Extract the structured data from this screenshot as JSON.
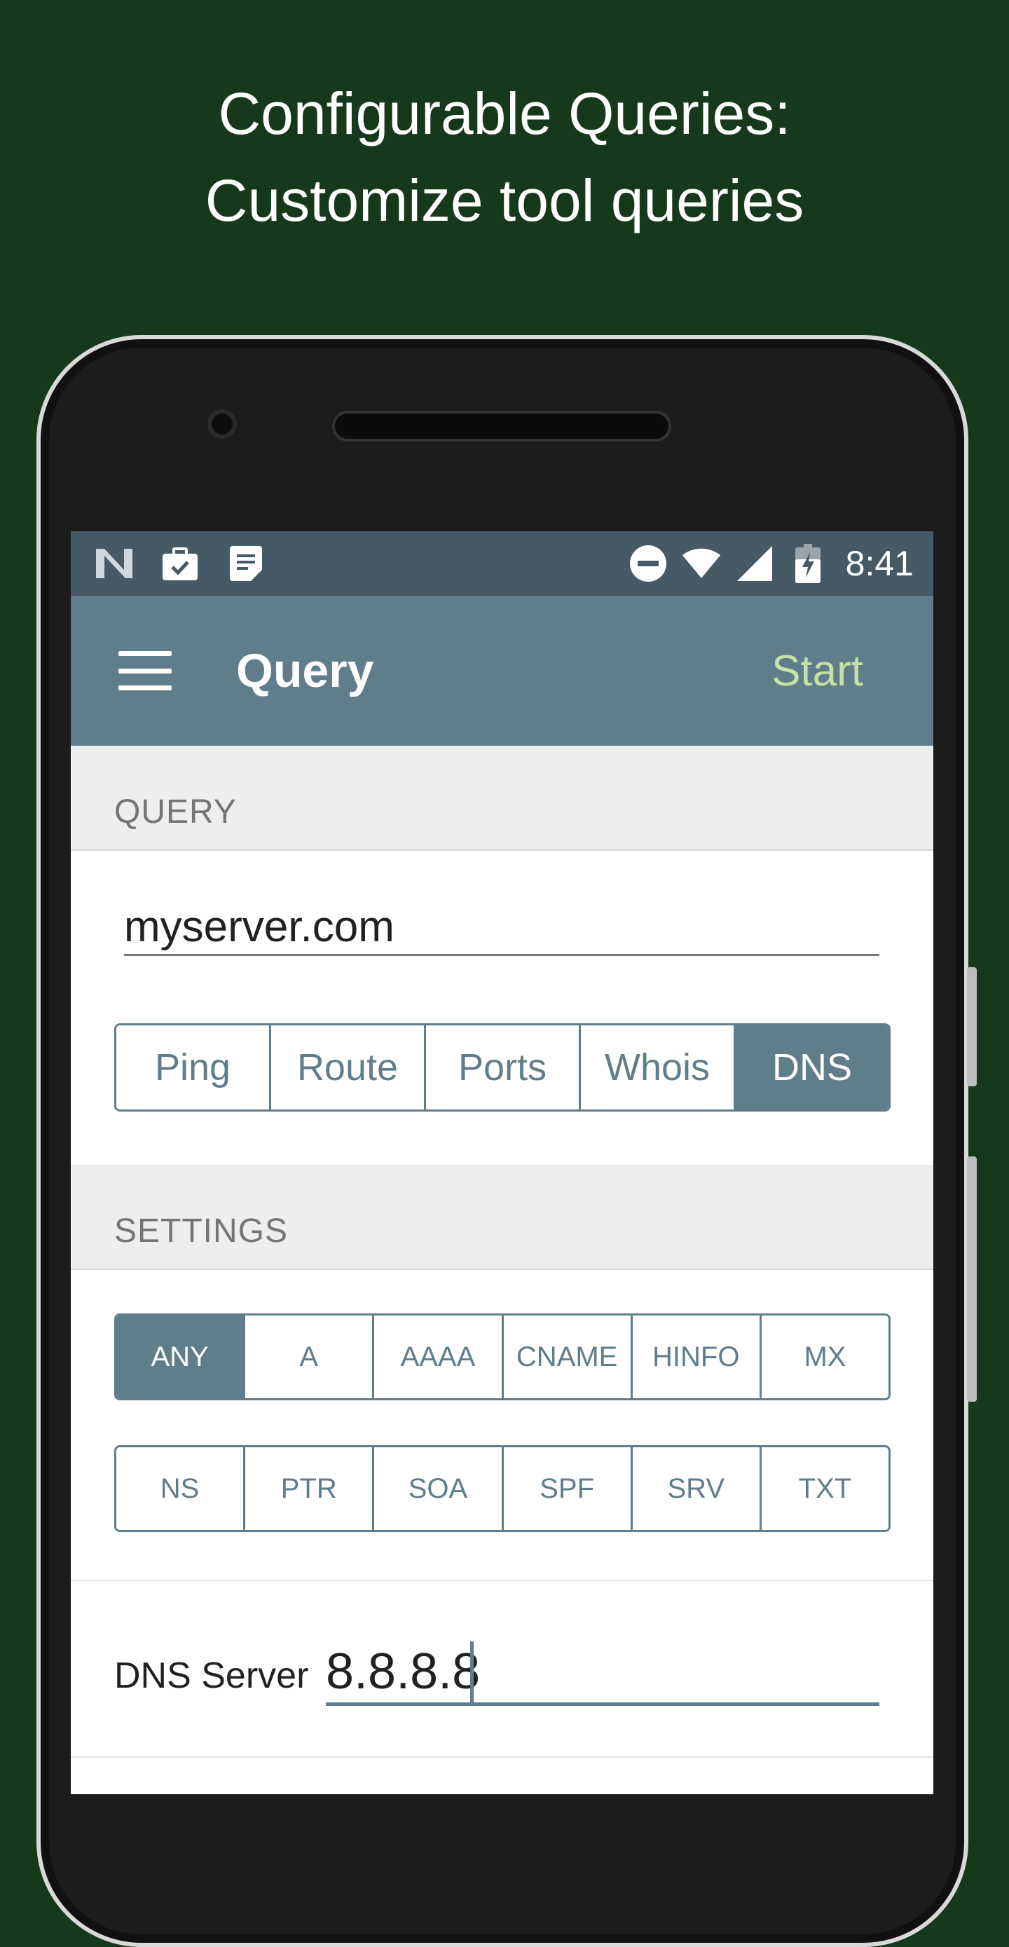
{
  "promo": {
    "line1": "Configurable Queries:",
    "line2": "Customize tool queries"
  },
  "status_bar": {
    "time": "8:41",
    "left_icons": [
      "n-logo-icon",
      "work-briefcase-icon",
      "notes-icon"
    ],
    "right_icons": [
      "do-not-disturb-icon",
      "wifi-icon",
      "cell-signal-icon",
      "battery-charging-icon"
    ]
  },
  "app_bar": {
    "title": "Query",
    "action": "Start"
  },
  "query_section": {
    "header": "QUERY",
    "input_value": "myserver.com",
    "tools": [
      "Ping",
      "Route",
      "Ports",
      "Whois",
      "DNS"
    ],
    "selected_tool": "DNS"
  },
  "settings_section": {
    "header": "SETTINGS",
    "record_types_row1": [
      "ANY",
      "A",
      "AAAA",
      "CNAME",
      "HINFO",
      "MX"
    ],
    "record_types_row2": [
      "NS",
      "PTR",
      "SOA",
      "SPF",
      "SRV",
      "TXT"
    ],
    "selected_record": "ANY",
    "dns_server_label": "DNS Server",
    "dns_server_value": "8.8.8.8"
  },
  "colors": {
    "background": "#15391a",
    "status_bar": "#455a64",
    "app_bar": "#607d8b",
    "accent_action": "#c5e1a5",
    "section_bg": "#eeeeee"
  }
}
